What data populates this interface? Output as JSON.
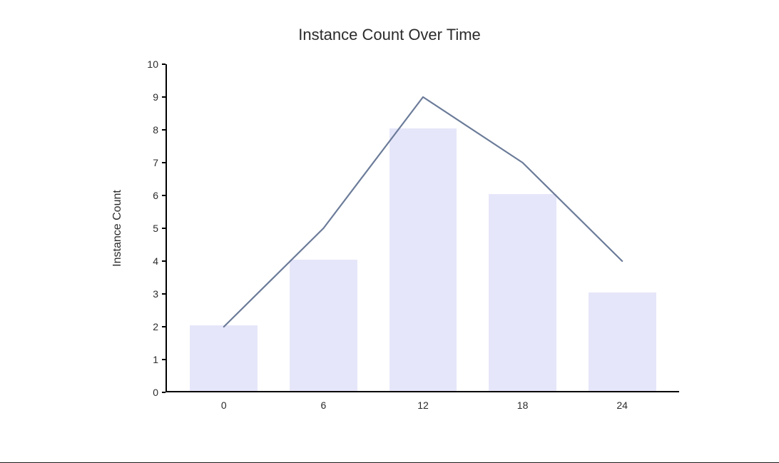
{
  "chart_data": {
    "type": "bar",
    "title": "Instance Count Over Time",
    "xlabel": "",
    "ylabel": "Instance Count",
    "categories": [
      "0",
      "6",
      "12",
      "18",
      "24"
    ],
    "series": [
      {
        "name": "bars",
        "kind": "bar",
        "values": [
          2,
          4,
          8,
          6,
          3
        ]
      },
      {
        "name": "line",
        "kind": "line",
        "values": [
          2,
          5,
          9,
          7,
          4
        ]
      }
    ],
    "ylim": [
      0,
      10
    ],
    "yticks": [
      0,
      1,
      2,
      3,
      4,
      5,
      6,
      7,
      8,
      9,
      10
    ],
    "colors": {
      "bar_fill": "#e6e6fa",
      "line_stroke": "#6b7b99"
    }
  }
}
